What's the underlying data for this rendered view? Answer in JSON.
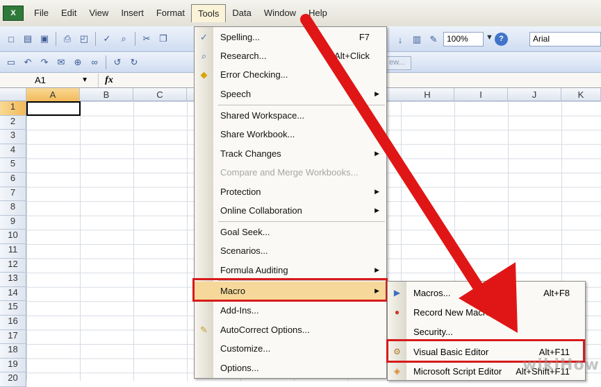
{
  "menubar": {
    "items": [
      {
        "label": "File"
      },
      {
        "label": "Edit"
      },
      {
        "label": "View"
      },
      {
        "label": "Insert"
      },
      {
        "label": "Format"
      },
      {
        "label": "Tools"
      },
      {
        "label": "Data"
      },
      {
        "label": "Window"
      },
      {
        "label": "Help"
      }
    ]
  },
  "toolbar": {
    "zoom": "100%",
    "font_name": "Arial",
    "field_text": "ew..."
  },
  "formula_bar": {
    "name_box": "A1",
    "fx_label": "fx"
  },
  "grid": {
    "columns": [
      "A",
      "B",
      "C",
      "",
      "",
      "",
      "",
      "H",
      "I",
      "J",
      "K"
    ],
    "rows": [
      "1",
      "2",
      "3",
      "4",
      "5",
      "6",
      "7",
      "8",
      "9",
      "10",
      "11",
      "12",
      "13",
      "14",
      "15",
      "16",
      "17",
      "18",
      "19",
      "20"
    ]
  },
  "tools_menu": {
    "items": [
      {
        "label": "Spelling...",
        "shortcut": "F7",
        "icon": "spelling-icon"
      },
      {
        "label": "Research...",
        "shortcut": "Alt+Click",
        "icon": "research-icon"
      },
      {
        "label": "Error Checking...",
        "shortcut": "",
        "icon": "error-check-icon"
      },
      {
        "label": "Speech",
        "shortcut": "",
        "icon": ""
      },
      {
        "label": "Shared Workspace...",
        "shortcut": "",
        "icon": ""
      },
      {
        "label": "Share Workbook...",
        "shortcut": "",
        "icon": ""
      },
      {
        "label": "Track Changes",
        "shortcut": "",
        "icon": ""
      },
      {
        "label": "Compare and Merge Workbooks...",
        "shortcut": "",
        "icon": ""
      },
      {
        "label": "Protection",
        "shortcut": "",
        "icon": ""
      },
      {
        "label": "Online Collaboration",
        "shortcut": "",
        "icon": ""
      },
      {
        "label": "Goal Seek...",
        "shortcut": "",
        "icon": ""
      },
      {
        "label": "Scenarios...",
        "shortcut": "",
        "icon": ""
      },
      {
        "label": "Formula Auditing",
        "shortcut": "",
        "icon": ""
      },
      {
        "label": "Macro",
        "shortcut": "",
        "icon": ""
      },
      {
        "label": "Add-Ins...",
        "shortcut": "",
        "icon": ""
      },
      {
        "label": "AutoCorrect Options...",
        "shortcut": "",
        "icon": "autocorrect-icon"
      },
      {
        "label": "Customize...",
        "shortcut": "",
        "icon": ""
      },
      {
        "label": "Options...",
        "shortcut": "",
        "icon": ""
      }
    ]
  },
  "macro_submenu": {
    "items": [
      {
        "label": "Macros...",
        "shortcut": "Alt+F8"
      },
      {
        "label": "Record New Macro...",
        "shortcut": ""
      },
      {
        "label": "Security...",
        "shortcut": ""
      },
      {
        "label": "Visual Basic Editor",
        "shortcut": "Alt+F11"
      },
      {
        "label": "Microsoft Script Editor",
        "shortcut": "Alt+Shift+F11"
      }
    ]
  },
  "colors": {
    "highlight": "#f6d99a",
    "annotation_red": "#d71a1a"
  },
  "watermark": "wikiHow"
}
